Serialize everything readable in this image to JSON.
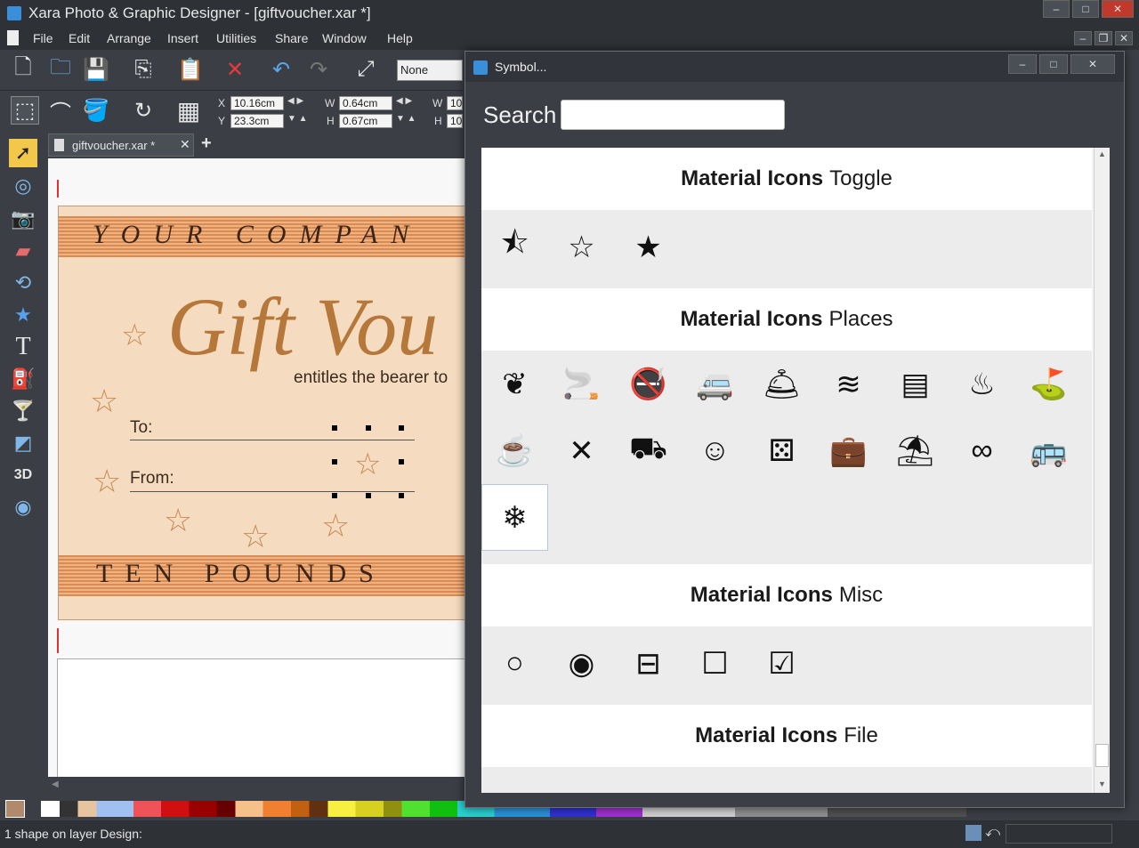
{
  "window": {
    "title": "Xara Photo & Graphic Designer - [giftvoucher.xar *]",
    "minimize": "–",
    "maximize": "□",
    "close": "✕"
  },
  "menu": [
    "File",
    "Edit",
    "Arrange",
    "Insert",
    "Utilities",
    "Share",
    "Window",
    "Help"
  ],
  "toolbar": {
    "quality_value": "None",
    "x_label": "X",
    "x_value": "10.16cm",
    "y_label": "Y",
    "y_value": "23.3cm",
    "w_label": "W",
    "w_value": "0.64cm",
    "h_label": "H",
    "h_value": "0.67cm",
    "w2_label": "W",
    "w2_value": "10",
    "h2_label": "H",
    "h2_value": "10"
  },
  "document": {
    "tab_label": "giftvoucher.xar *",
    "tab_close": "✕",
    "new_tab": "+"
  },
  "voucher": {
    "company": "YOUR COMPAN",
    "headline": "Gift Vou",
    "subline": "entitles the bearer to",
    "to_label": "To:",
    "from_label": "From:",
    "amount": "TEN POUNDS"
  },
  "dialog": {
    "title": "Symbol...",
    "search_label": "Search",
    "search_value": "",
    "sections": [
      {
        "prefix": "Material Icons",
        "name": "Toggle"
      },
      {
        "prefix": "Material Icons",
        "name": "Places"
      },
      {
        "prefix": "Material Icons",
        "name": "Misc"
      },
      {
        "prefix": "Material Icons",
        "name": "File"
      }
    ],
    "toggle_icons": [
      "star-half-icon",
      "star-outline-icon",
      "star-filled-icon"
    ],
    "places_icons": [
      "spa-icon",
      "smoking-icon",
      "no-smoking-icon",
      "rv-icon",
      "room-service-icon",
      "pool-icon",
      "kitchen-icon",
      "hot-tub-icon",
      "golf-icon",
      "free-breakfast-icon",
      "fitness-icon",
      "stroller-icon",
      "child-care-icon",
      "casino-icon",
      "business-center-icon",
      "beach-access-icon",
      "all-inclusive-icon",
      "airport-shuttle-icon",
      "ac-unit-icon"
    ],
    "misc_icons": [
      "radio-unchecked-icon",
      "radio-checked-icon",
      "indeterminate-checkbox-icon",
      "checkbox-outline-icon",
      "checkbox-checked-icon"
    ]
  },
  "status": {
    "text": "1 shape on layer Design:"
  },
  "colors": {
    "accent": "#d88b54",
    "headline": "#b5773a"
  }
}
